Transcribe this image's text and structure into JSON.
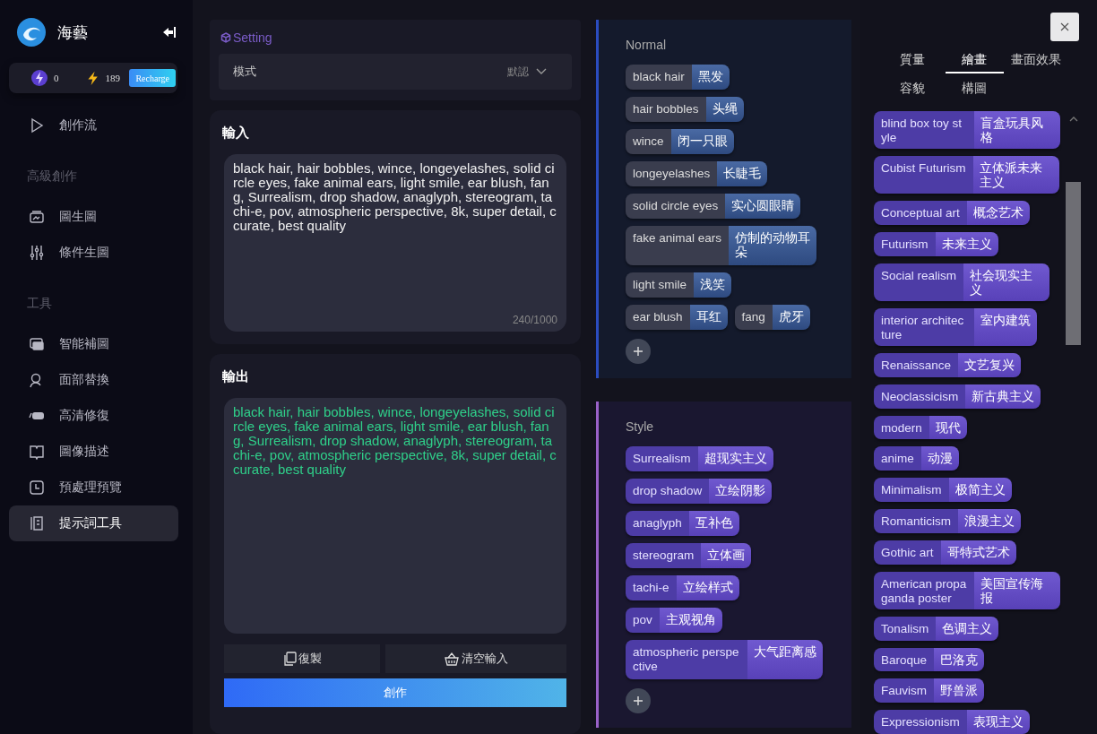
{
  "sidebar": {
    "brand": "海藝",
    "credits": [
      {
        "kind": "purple",
        "value": "0"
      },
      {
        "kind": "yellow",
        "value": "189"
      }
    ],
    "recharge": "Recharge",
    "nav": [
      {
        "kind": "item",
        "label": "創作流",
        "selected": false
      },
      {
        "kind": "header",
        "label": "高級創作"
      },
      {
        "kind": "item",
        "label": "圖生圖",
        "selected": false
      },
      {
        "kind": "item",
        "label": "條件生圖",
        "selected": false
      },
      {
        "kind": "header",
        "label": "工具"
      },
      {
        "kind": "item",
        "label": "智能補圖",
        "selected": false
      },
      {
        "kind": "item",
        "label": "面部替換",
        "selected": false
      },
      {
        "kind": "item",
        "label": "高清修復",
        "selected": false
      },
      {
        "kind": "item",
        "label": "圖像描述",
        "selected": false
      },
      {
        "kind": "item",
        "label": "預處理預覽",
        "selected": false
      },
      {
        "kind": "item",
        "label": "提示詞工具",
        "selected": true
      }
    ]
  },
  "setting": {
    "title": "Setting",
    "mode_label": "模式",
    "mode_value": "默認"
  },
  "input": {
    "title": "輸入",
    "value": "black hair, hair bobbles, wince, longeyelashes, solid circle eyes, fake animal ears, light smile, ear blush, fang, Surrealism, drop shadow, anaglyph, stereogram, tachi-e, pov, atmospheric perspective, 8k, super detail, ccurate, best quality",
    "counter": "240/1000"
  },
  "output": {
    "title": "輸出",
    "value": "black hair, hair bobbles, wince, longeyelashes, solid circle eyes, fake animal ears, light smile, ear blush, fang, Surrealism, drop shadow, anaglyph, stereogram, tachi-e, pov, atmospheric perspective, 8k, super detail, ccurate, best quality"
  },
  "buttons": {
    "copy": "復製",
    "clear": "清空輸入",
    "create": "創作"
  },
  "groups": [
    {
      "kind": "normal",
      "title": "Normal",
      "tags": [
        {
          "en": "black hair",
          "zh": "黑发"
        },
        {
          "en": "hair bobbles",
          "zh": "头绳"
        },
        {
          "en": "wince",
          "zh": "闭一只眼"
        },
        {
          "en": "longeyelashes",
          "zh": "长睫毛"
        },
        {
          "en": "solid circle eyes",
          "zh": "实心圆眼睛"
        },
        {
          "en": "fake animal ears",
          "zh": "仿制的动物耳朵"
        },
        {
          "en": "light smile",
          "zh": "浅笑"
        },
        {
          "en": "ear blush",
          "zh": "耳红"
        },
        {
          "en": "fang",
          "zh": "虎牙"
        }
      ]
    },
    {
      "kind": "style",
      "title": "Style",
      "tags": [
        {
          "en": "Surrealism",
          "zh": "超现实主义"
        },
        {
          "en": "drop shadow",
          "zh": "立绘阴影"
        },
        {
          "en": "anaglyph",
          "zh": "互补色"
        },
        {
          "en": "stereogram",
          "zh": "立体画"
        },
        {
          "en": "tachi-e",
          "zh": "立绘样式"
        },
        {
          "en": "pov",
          "zh": "主观视角"
        },
        {
          "en": "atmospheric perspective",
          "zh": "大气距离感"
        }
      ]
    }
  ],
  "library": {
    "tabs": [
      {
        "label": "質量",
        "selected": false
      },
      {
        "label": "繪畫",
        "selected": true
      },
      {
        "label": "畫面效果",
        "selected": false
      },
      {
        "label": "容貌",
        "selected": false
      },
      {
        "label": "構圖",
        "selected": false
      }
    ],
    "tags": [
      {
        "en": "blind box toy style",
        "zh": "盲盒玩具风格"
      },
      {
        "en": "Cubist Futurism",
        "zh": "立体派未来主义"
      },
      {
        "en": "Conceptual art",
        "zh": "概念艺术"
      },
      {
        "en": "Futurism",
        "zh": "未来主义"
      },
      {
        "en": "Social realism",
        "zh": "社会现实主义"
      },
      {
        "en": "interior architecture",
        "zh": "室内建筑"
      },
      {
        "en": "Renaissance",
        "zh": "文艺复兴"
      },
      {
        "en": "Neoclassicism",
        "zh": "新古典主义"
      },
      {
        "en": "modern",
        "zh": "现代"
      },
      {
        "en": "anime",
        "zh": "动漫"
      },
      {
        "en": "Minimalism",
        "zh": "极简主义"
      },
      {
        "en": "Romanticism",
        "zh": "浪漫主义"
      },
      {
        "en": "Gothic art",
        "zh": "哥特式艺术"
      },
      {
        "en": "American propaganda poster",
        "zh": "美国宣传海报"
      },
      {
        "en": "Tonalism",
        "zh": "色调主义"
      },
      {
        "en": "Baroque",
        "zh": "巴洛克"
      },
      {
        "en": "Fauvism",
        "zh": "野兽派"
      },
      {
        "en": "Expressionism",
        "zh": "表现主义"
      }
    ]
  }
}
